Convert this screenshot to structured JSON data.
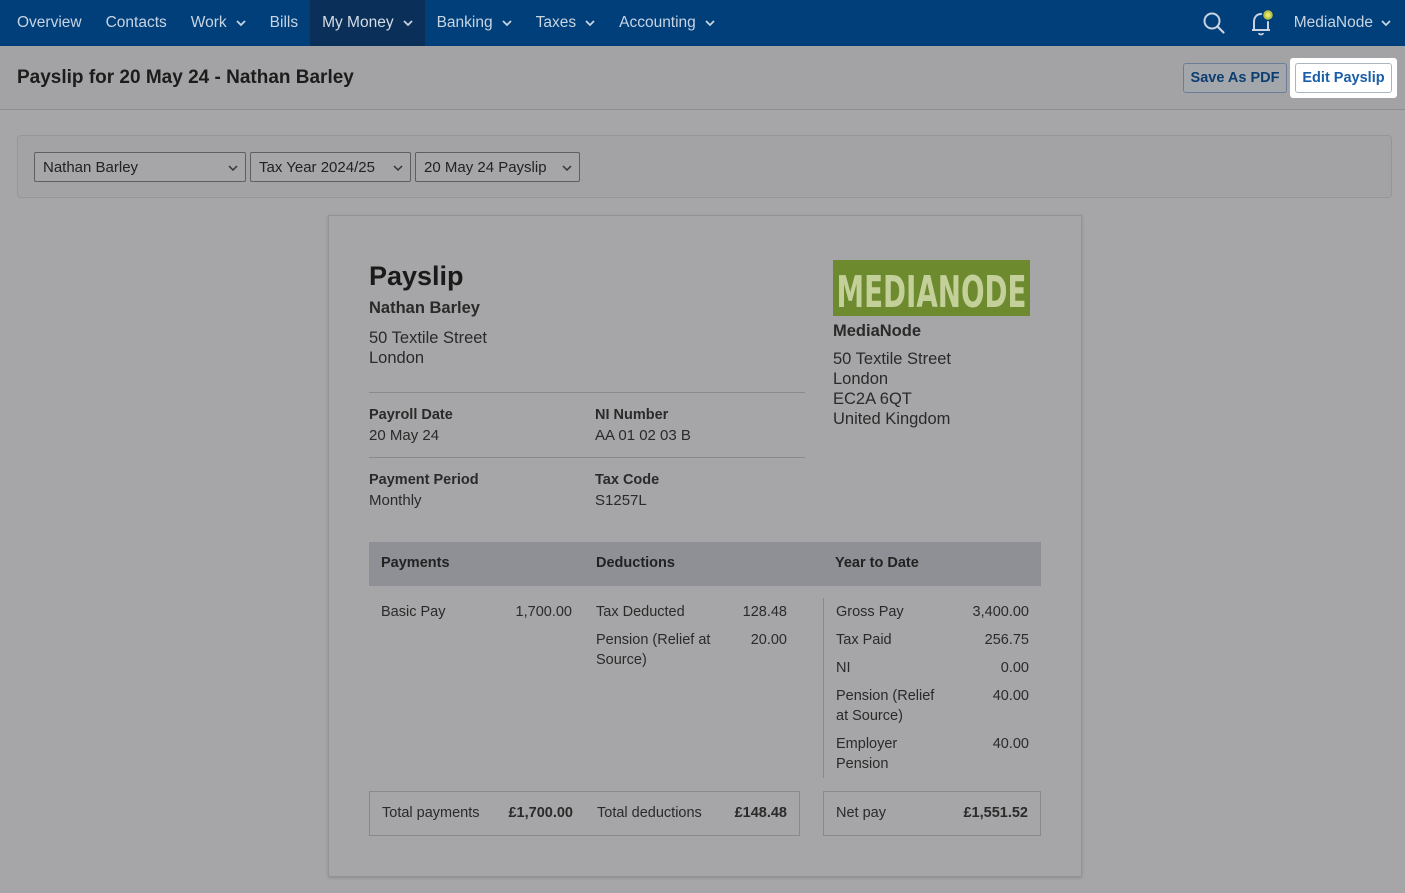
{
  "nav": {
    "items": [
      {
        "label": "Overview",
        "dropdown": false
      },
      {
        "label": "Contacts",
        "dropdown": false
      },
      {
        "label": "Work",
        "dropdown": true
      },
      {
        "label": "Bills",
        "dropdown": false
      },
      {
        "label": "My Money",
        "dropdown": true,
        "active": true
      },
      {
        "label": "Banking",
        "dropdown": true
      },
      {
        "label": "Taxes",
        "dropdown": true
      },
      {
        "label": "Accounting",
        "dropdown": true
      }
    ],
    "user": "MediaNode"
  },
  "header": {
    "title": "Payslip for 20 May 24 - Nathan Barley",
    "save_pdf_label": "Save As PDF",
    "edit_label": "Edit Payslip"
  },
  "filters": {
    "employee": "Nathan Barley",
    "tax_year": "Tax Year 2024/25",
    "payslip": "20 May 24 Payslip"
  },
  "payslip": {
    "heading": "Payslip",
    "employee_name": "Nathan Barley",
    "employee_address": [
      "50 Textile Street",
      "London"
    ],
    "payroll_date_label": "Payroll Date",
    "payroll_date": "20 May 24",
    "ni_number_label": "NI Number",
    "ni_number": "AA 01 02 03 B",
    "payment_period_label": "Payment Period",
    "payment_period": "Monthly",
    "tax_code_label": "Tax Code",
    "tax_code": "S1257L",
    "company": {
      "logo_text": "MEDIANODE",
      "name": "MediaNode",
      "address": [
        "50 Textile Street",
        "London",
        "EC2A 6QT",
        "United Kingdom"
      ]
    },
    "columns": {
      "payments": "Payments",
      "deductions": "Deductions",
      "ytd": "Year to Date"
    },
    "payments": [
      {
        "label": "Basic Pay",
        "value": "1,700.00"
      }
    ],
    "deductions": [
      {
        "label": "Tax Deducted",
        "value": "128.48"
      },
      {
        "label": "Pension (Relief at Source)",
        "value": "20.00"
      }
    ],
    "ytd": [
      {
        "label": "Gross Pay",
        "value": "3,400.00"
      },
      {
        "label": "Tax Paid",
        "value": "256.75"
      },
      {
        "label": "NI",
        "value": "0.00"
      },
      {
        "label": "Pension (Relief at Source)",
        "value": "40.00"
      },
      {
        "label": "Employer Pension",
        "value": "40.00"
      }
    ],
    "totals": {
      "payments_label": "Total payments",
      "payments_value": "£1,700.00",
      "deductions_label": "Total deductions",
      "deductions_value": "£148.48",
      "net_label": "Net pay",
      "net_value": "£1,551.52"
    }
  },
  "colors": {
    "nav_bg": "#003f7a",
    "logo_green": "#6d8a2e",
    "link_blue": "#1a5ea8"
  }
}
